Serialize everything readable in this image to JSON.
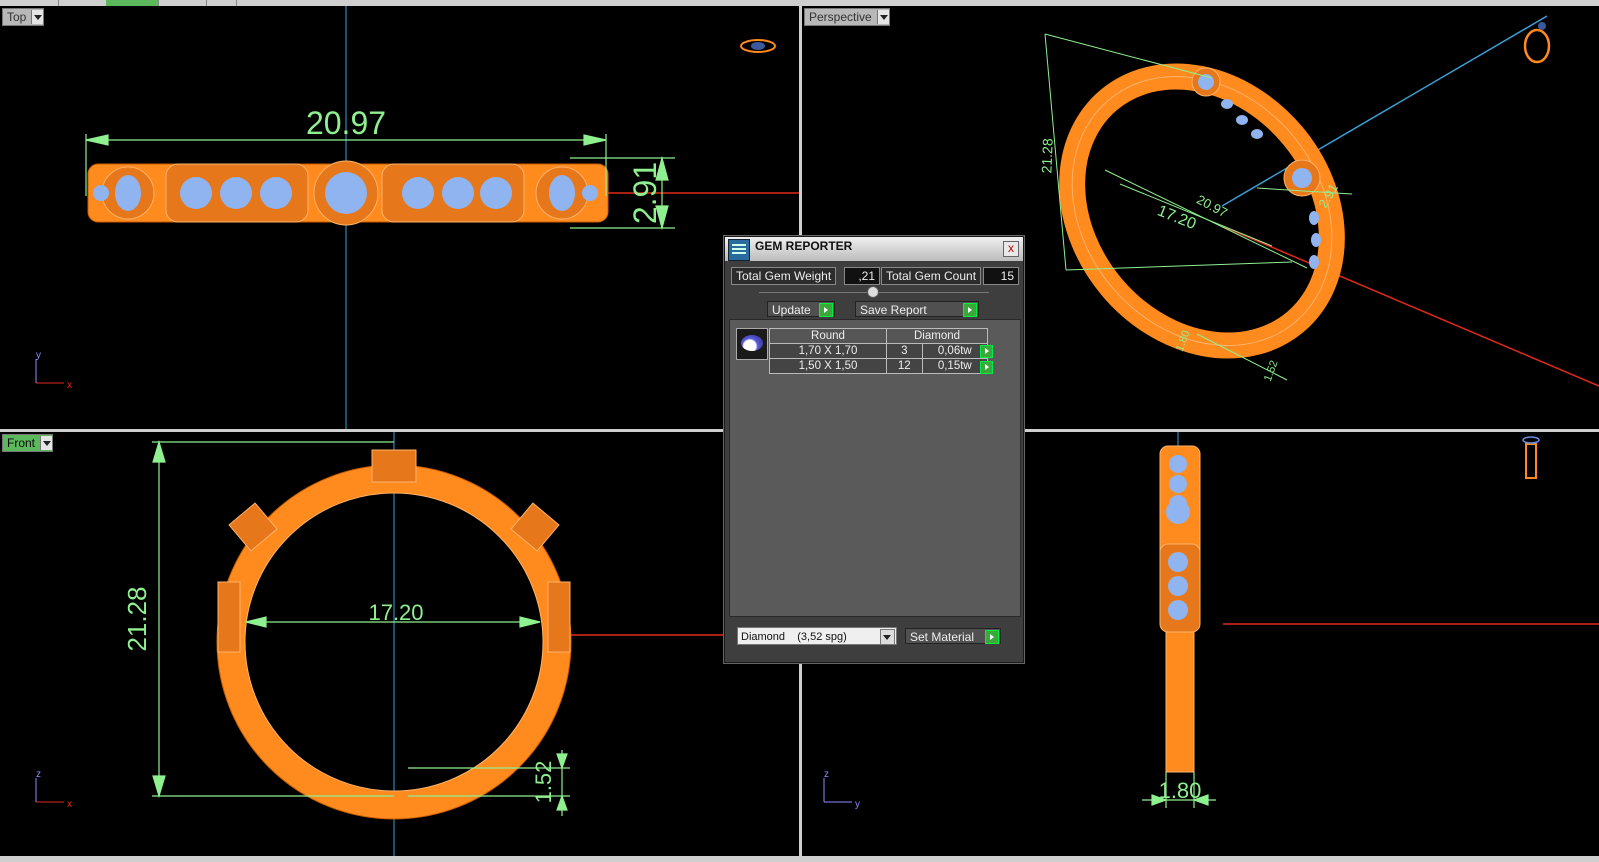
{
  "viewports": {
    "top": {
      "label": "Top",
      "dim_width": "20.97",
      "dim_height": "2.91",
      "axis_v": "y",
      "axis_h": "x"
    },
    "perspective": {
      "label": "Perspective",
      "dim_a": "21.28",
      "dim_b": "20.97",
      "dim_c": "17.20",
      "dim_d": "2.91",
      "dim_e": "1.80",
      "dim_f": "1.52"
    },
    "front": {
      "label": "Front",
      "dim_height": "21.28",
      "dim_inner": "17.20",
      "dim_bottom": "1.52",
      "axis_v": "z",
      "axis_h": "x"
    },
    "right": {
      "dim_width": "1.80",
      "axis_v": "z",
      "axis_h": "y"
    }
  },
  "gem_reporter": {
    "title": "GEM REPORTER",
    "close": "x",
    "total_weight_label": "Total Gem Weight",
    "total_weight_value": ",21",
    "total_count_label": "Total Gem Count",
    "total_count_value": "15",
    "update_label": "Update",
    "save_report_label": "Save Report",
    "table": {
      "header_shape": "Round",
      "header_type": "Diamond",
      "rows": [
        {
          "size": "1,70 X 1,70",
          "count": "3",
          "weight": "0,06tw"
        },
        {
          "size": "1,50 X 1,50",
          "count": "12",
          "weight": "0,15tw"
        }
      ]
    },
    "material_select": "Diamond    (3,52 spg)",
    "set_material_label": "Set Material"
  },
  "colors": {
    "metal": "#ff8a1e",
    "gem": "#8fb4f0",
    "dimension": "#8ff08f",
    "axis_red": "#e02a1a",
    "axis_blue": "#3aa0d8"
  },
  "icons": [
    "ring-top-icon",
    "ring-perspective-icon",
    "ring-side-icon",
    "dialog-app-icon",
    "close-icon",
    "play-arrow-icon",
    "chevron-down-icon"
  ]
}
